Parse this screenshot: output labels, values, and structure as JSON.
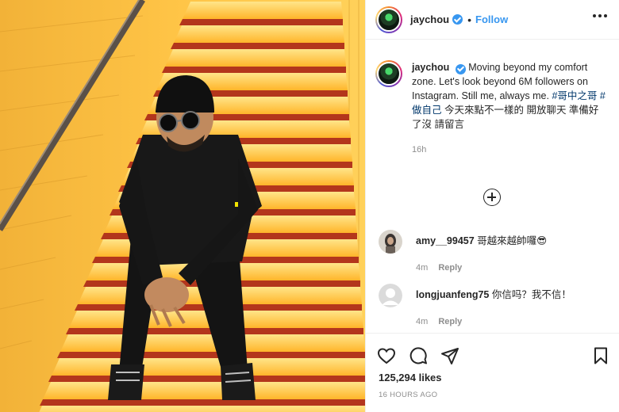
{
  "post": {
    "username": "jaychou",
    "follow_label": "Follow",
    "caption": {
      "username": "jaychou",
      "text_before": "Moving beyond my comfort zone. Let's look beyond 6M followers on Instagram. Still me, always me. ",
      "hashtag_1": "#哥中之哥",
      "hashtag_2": "#做自己",
      "text_after": " 今天來點不一樣的 開放聊天 準備好了沒 請留言",
      "time": "16h"
    },
    "comments": [
      {
        "username": "amy__99457",
        "text": "哥越來越帥囉😎",
        "time": "4m",
        "reply_label": "Reply"
      },
      {
        "username": "longjuanfeng75",
        "text": "你信吗？我不信！",
        "time": "4m",
        "reply_label": "Reply"
      }
    ],
    "likes": "125,294 likes",
    "posted_time": "16 HOURS AGO"
  },
  "icons": [
    "heart-icon",
    "comment-icon",
    "share-icon",
    "bookmark-icon",
    "more-options-icon",
    "load-more-icon",
    "verified-badge-icon"
  ],
  "colors": {
    "accent": "#3897f0",
    "hashtag": "#00376b",
    "muted": "#8e8e8e",
    "photo_glow": "#ffb000"
  }
}
